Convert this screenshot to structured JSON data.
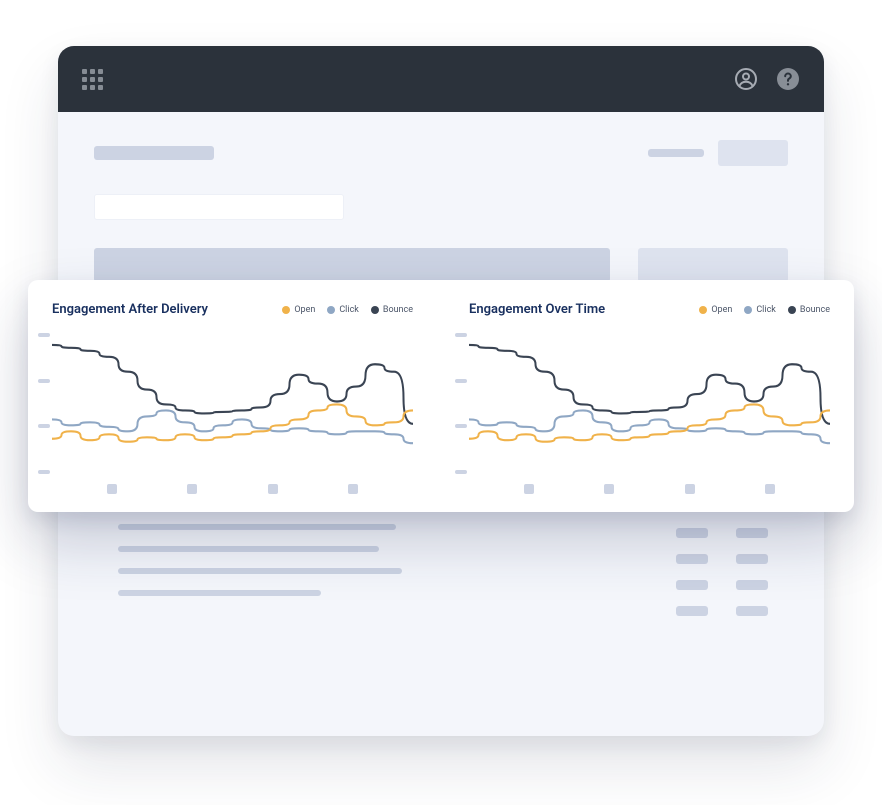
{
  "colors": {
    "open": "#f0b24a",
    "click": "#8fa7c4",
    "bounce": "#3a4453"
  },
  "charts": [
    {
      "title": "Engagement After Delivery",
      "legend": [
        {
          "key": "open",
          "label": "Open"
        },
        {
          "key": "click",
          "label": "Click"
        },
        {
          "key": "bounce",
          "label": "Bounce"
        }
      ]
    },
    {
      "title": "Engagement Over Time",
      "legend": [
        {
          "key": "open",
          "label": "Open"
        },
        {
          "key": "click",
          "label": "Click"
        },
        {
          "key": "bounce",
          "label": "Bounce"
        }
      ]
    }
  ],
  "chart_data": [
    {
      "type": "line",
      "title": "Engagement After Delivery",
      "xlabel": "",
      "ylabel": "",
      "ylim": [
        0,
        100
      ],
      "x": [
        0,
        1,
        2,
        3,
        4,
        5,
        6,
        7,
        8,
        9,
        10,
        11,
        12,
        13,
        14,
        15,
        16,
        17,
        18,
        19
      ],
      "series": [
        {
          "name": "Bounce",
          "color": "#3a4453",
          "values": [
            88,
            86,
            84,
            80,
            70,
            58,
            48,
            44,
            42,
            43,
            44,
            46,
            55,
            68,
            62,
            50,
            60,
            75,
            70,
            35
          ]
        },
        {
          "name": "Click",
          "color": "#8fa7c4",
          "values": [
            38,
            34,
            36,
            33,
            30,
            40,
            44,
            36,
            30,
            34,
            38,
            32,
            30,
            32,
            30,
            28,
            30,
            30,
            28,
            22
          ]
        },
        {
          "name": "Open",
          "color": "#f0b24a",
          "values": [
            25,
            30,
            24,
            28,
            23,
            26,
            24,
            28,
            24,
            26,
            28,
            30,
            34,
            38,
            44,
            48,
            40,
            34,
            36,
            44
          ]
        }
      ]
    },
    {
      "type": "line",
      "title": "Engagement Over Time",
      "xlabel": "",
      "ylabel": "",
      "ylim": [
        0,
        100
      ],
      "x": [
        0,
        1,
        2,
        3,
        4,
        5,
        6,
        7,
        8,
        9,
        10,
        11,
        12,
        13,
        14,
        15,
        16,
        17,
        18,
        19
      ],
      "series": [
        {
          "name": "Bounce",
          "color": "#3a4453",
          "values": [
            88,
            86,
            84,
            80,
            70,
            58,
            48,
            44,
            42,
            43,
            44,
            46,
            55,
            68,
            62,
            50,
            60,
            75,
            70,
            35
          ]
        },
        {
          "name": "Click",
          "color": "#8fa7c4",
          "values": [
            38,
            34,
            36,
            33,
            30,
            40,
            44,
            36,
            30,
            34,
            38,
            32,
            30,
            32,
            30,
            28,
            30,
            30,
            28,
            22
          ]
        },
        {
          "name": "Open",
          "color": "#f0b24a",
          "values": [
            25,
            30,
            24,
            28,
            23,
            26,
            24,
            28,
            24,
            26,
            28,
            30,
            34,
            38,
            44,
            48,
            40,
            34,
            36,
            44
          ]
        }
      ]
    }
  ]
}
